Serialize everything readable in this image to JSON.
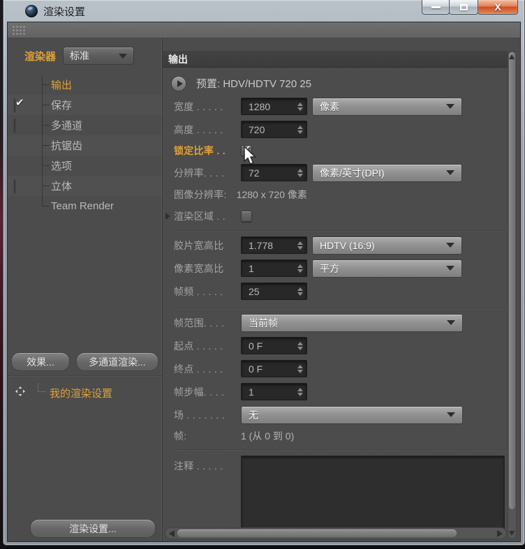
{
  "window": {
    "title": "渲染设置",
    "close_glyph": "X"
  },
  "sidebar": {
    "renderer_label": "渲染器",
    "renderer_value": "标准",
    "tree": [
      {
        "label": "输出"
      },
      {
        "label": "保存"
      },
      {
        "label": "多通道"
      },
      {
        "label": "抗锯齿"
      },
      {
        "label": "选项"
      },
      {
        "label": "立体"
      },
      {
        "label": "Team Render"
      }
    ],
    "effects_button": "效果...",
    "multipass_button": "多通道渲染...",
    "preset_item": "我的渲染设置",
    "render_settings_button": "渲染设置..."
  },
  "panel": {
    "header": "输出",
    "preset_text": "预置: HDV/HDTV 720 25",
    "width": {
      "label": "宽度 . . . . .",
      "value": "1280",
      "unit": "像素"
    },
    "height": {
      "label": "高度 . . . . .",
      "value": "720"
    },
    "lock_ratio": {
      "label": "锁定比率 . ."
    },
    "resolution": {
      "label": "分辨率. . . .",
      "value": "72",
      "unit": "像素/英寸(DPI)"
    },
    "image_resolution": {
      "label": "图像分辨率:",
      "value": "1280 x 720 像素"
    },
    "render_region": {
      "label": "渲染区域 . ."
    },
    "film_aspect": {
      "label": "胶片宽高比",
      "value": "1.778",
      "unit": "HDTV (16:9)"
    },
    "pixel_aspect": {
      "label": "像素宽高比",
      "value": "1",
      "unit": "平方"
    },
    "frame_rate": {
      "label": "帧频 . . . . .",
      "value": "25"
    },
    "frame_range": {
      "label": "帧范围. . . .",
      "value": "当前帧"
    },
    "start": {
      "label": "起点 . . . . .",
      "value": "0 F"
    },
    "end": {
      "label": "终点 . . . . .",
      "value": "0 F"
    },
    "frame_step": {
      "label": "帧步幅. . . .",
      "value": "1"
    },
    "field": {
      "label": "场 . . . . . . .",
      "value": "无"
    },
    "frames": {
      "label": "帧:",
      "value": "1 (从 0 到 0)"
    },
    "annotation": {
      "label": "注释 . . . . ."
    }
  }
}
